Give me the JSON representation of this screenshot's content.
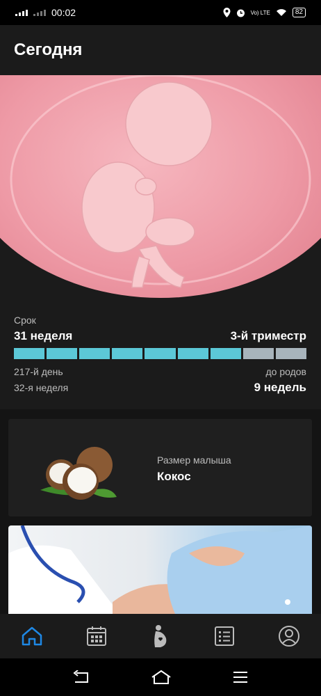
{
  "status_bar": {
    "time": "00:02",
    "battery": "82",
    "network": "Vo) LTE"
  },
  "header": {
    "title": "Сегодня"
  },
  "term": {
    "label": "Срок",
    "week": "31 неделя",
    "trimester": "3-й триместр",
    "progress_filled": 7,
    "progress_total": 9,
    "day": "217-й день",
    "week_current": "32-я неделя",
    "until_label": "до родов",
    "until_value": "9 недель",
    "bar_color": "#5cc8d7",
    "bar_empty_color": "#a8b4bc"
  },
  "baby_size": {
    "label": "Размер малыша",
    "value": "Кокос"
  },
  "nav": {
    "items": [
      {
        "icon": "home-icon",
        "active": true
      },
      {
        "icon": "calendar-icon",
        "active": false
      },
      {
        "icon": "pregnancy-icon",
        "active": false
      },
      {
        "icon": "list-icon",
        "active": false
      },
      {
        "icon": "profile-icon",
        "active": false
      }
    ],
    "active_color": "#1e88e5"
  }
}
